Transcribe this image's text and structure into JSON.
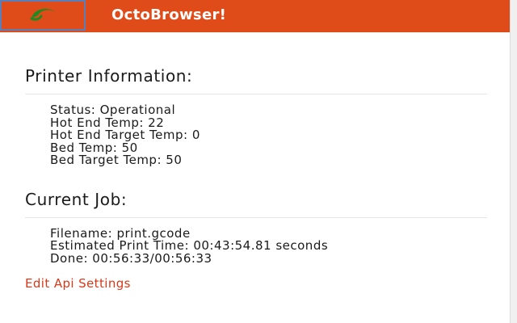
{
  "header": {
    "title": "OctoBrowser!",
    "logo_icon": "octoprint-logo-icon",
    "bar_color": "#e04b1a"
  },
  "printer": {
    "heading": "Printer Information:",
    "status": "Status: Operational",
    "hot_end_temp": "Hot End Temp: 22",
    "hot_end_target": "Hot End Target Temp: 0",
    "bed_temp": "Bed Temp: 50",
    "bed_target": "Bed Target Temp: 50"
  },
  "job": {
    "heading": "Current Job:",
    "filename": "Filename: print.gcode",
    "estimated_time": "Estimated Print Time: 00:43:54.81 seconds",
    "done": "Done: 00:56:33/00:56:33"
  },
  "links": {
    "edit_api": "Edit Api Settings",
    "link_color": "#d63a1a"
  }
}
